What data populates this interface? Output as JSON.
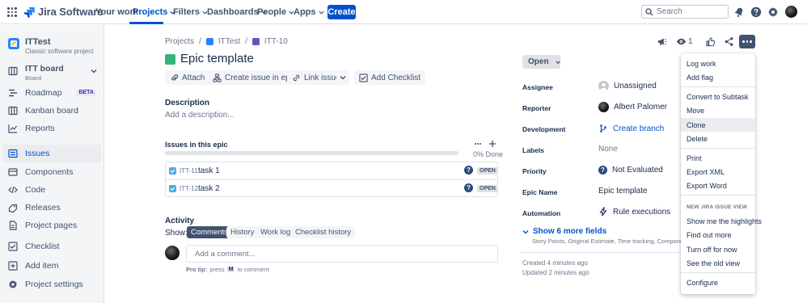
{
  "topnav": {
    "app_name": "Jira Software",
    "items": [
      {
        "label": "Your work"
      },
      {
        "label": "Projects"
      },
      {
        "label": "Filters"
      },
      {
        "label": "Dashboards"
      },
      {
        "label": "People"
      },
      {
        "label": "Apps"
      }
    ],
    "create_label": "Create",
    "search_placeholder": "Search",
    "accent": "#0052CC"
  },
  "sidebar": {
    "project_name": "ITTest",
    "project_type": "Classic software project",
    "board_name": "ITT board",
    "board_sub": "Board",
    "items": [
      {
        "label": "Roadmap",
        "icon": "roadmap-icon",
        "badge": "BETA"
      },
      {
        "label": "Kanban board",
        "icon": "kanban-icon"
      },
      {
        "label": "Reports",
        "icon": "reports-icon"
      },
      {
        "label": "Issues",
        "icon": "issues-icon"
      },
      {
        "label": "Components",
        "icon": "components-icon"
      },
      {
        "label": "Code",
        "icon": "code-icon"
      },
      {
        "label": "Releases",
        "icon": "releases-icon"
      },
      {
        "label": "Project pages",
        "icon": "pages-icon"
      },
      {
        "label": "Checklist",
        "icon": "checklist-icon"
      },
      {
        "label": "Add item",
        "icon": "add-item-icon"
      },
      {
        "label": "Project settings",
        "icon": "settings-icon"
      }
    ]
  },
  "breadcrumbs": [
    "Projects",
    "ITTest",
    "ITT-10"
  ],
  "issue": {
    "title": "Epic template",
    "toolbar": {
      "attach": "Attach",
      "create_in_epic": "Create issue in epic",
      "link_issue": "Link issue",
      "add_checklist": "Add Checklist"
    },
    "description_label": "Description",
    "description_placeholder": "Add a description...",
    "epic_issues_label": "Issues in this epic",
    "progress_text": "0% Done",
    "progress_fraction": 0,
    "children": [
      {
        "key": "ITT-11",
        "summary": "task 1",
        "status": "OPEN"
      },
      {
        "key": "ITT-12",
        "summary": "task 2",
        "status": "OPEN"
      }
    ],
    "activity": {
      "label": "Activity",
      "show_label": "Show:",
      "filters": [
        "Comments",
        "History",
        "Work log",
        "Checklist history"
      ],
      "comment_placeholder": "Add a comment...",
      "protip_prefix": "Pro tip:",
      "protip_press": "press",
      "protip_key": "M",
      "protip_suffix": "to comment"
    }
  },
  "details": {
    "status": "Open",
    "watch_count": "1",
    "fields": [
      {
        "label": "Assignee",
        "value": "Unassigned"
      },
      {
        "label": "Reporter",
        "value": "Albert Palomer"
      },
      {
        "label": "Development",
        "value": "Create branch"
      },
      {
        "label": "Labels",
        "value": "None"
      },
      {
        "label": "Priority",
        "value": "Not Evaluated"
      },
      {
        "label": "Epic Name",
        "value": "Epic template"
      },
      {
        "label": "Automation",
        "value": "Rule executions"
      }
    ],
    "more_fields": "Show 6 more fields",
    "more_fields_sub": "Story Points, Original Estimate, Time tracking, Components, Fix versions",
    "created": "Created 4 minutes ago",
    "updated": "Updated 2 minutes ago"
  },
  "dropdown": {
    "group1": [
      "Log work",
      "Add flag"
    ],
    "group2": [
      "Convert to Subtask",
      "Move",
      "Clone",
      "Delete"
    ],
    "group3": [
      "Print",
      "Export XML",
      "Export Word"
    ],
    "heading": "NEW JIRA ISSUE VIEW",
    "group4": [
      "Show me the highlights",
      "Find out more",
      "Turn off for now",
      "See the old view"
    ],
    "group5": [
      "Configure"
    ],
    "hovered": "Clone"
  }
}
